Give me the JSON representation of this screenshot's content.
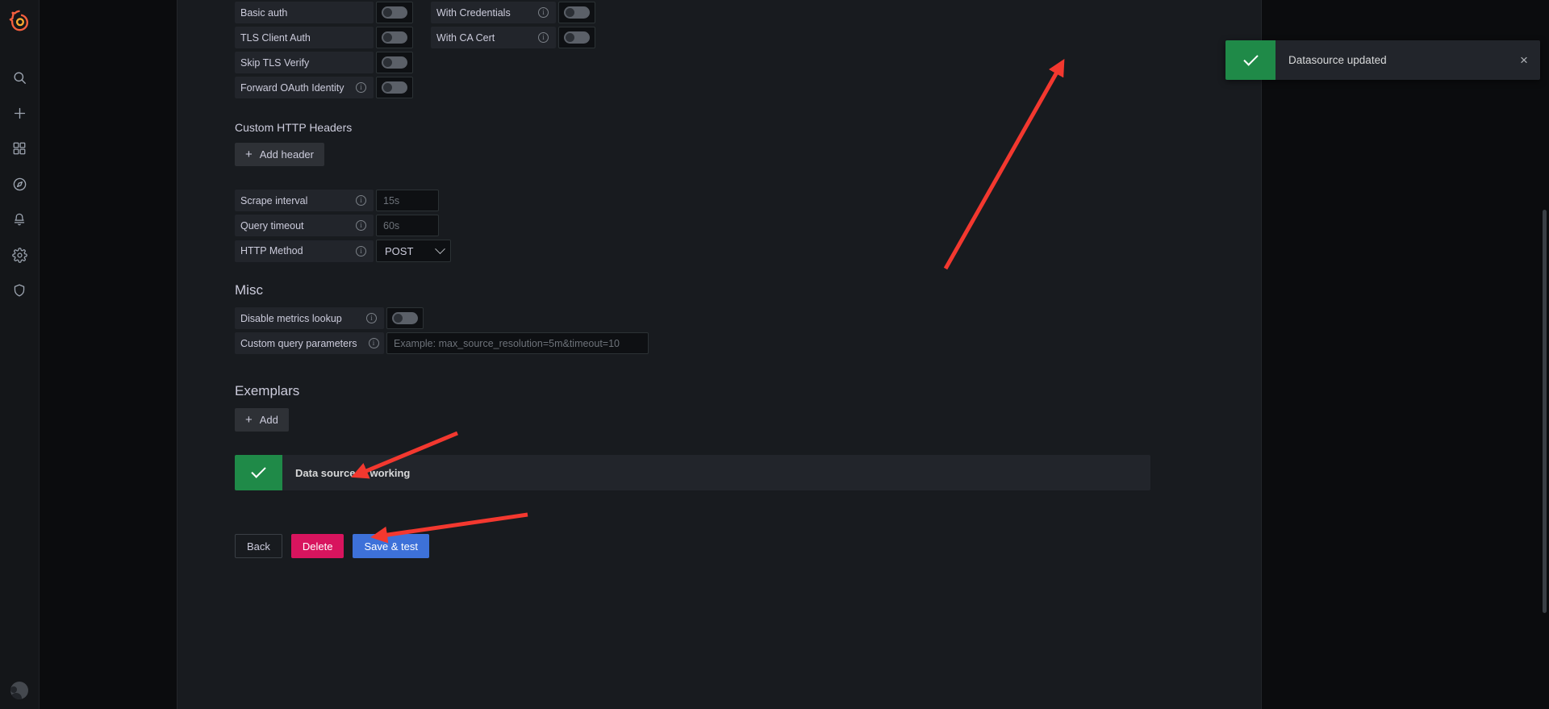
{
  "app": {
    "brand": "grafana",
    "accent_blue": "#3d71d9",
    "accent_green": "#1f8a48",
    "accent_pink": "#d8145e",
    "annotation_color": "#f3382f"
  },
  "sidebar": {
    "logo_name": "grafana-logo",
    "items": [
      {
        "name": "search-icon",
        "label": "Search"
      },
      {
        "name": "plus-icon",
        "label": "Create"
      },
      {
        "name": "dashboards-icon",
        "label": "Dashboards"
      },
      {
        "name": "explore-compass-icon",
        "label": "Explore"
      },
      {
        "name": "alerting-bell-icon",
        "label": "Alerting"
      },
      {
        "name": "configuration-gear-icon",
        "label": "Configuration"
      },
      {
        "name": "shield-icon",
        "label": "Server Admin"
      }
    ],
    "avatar_label": "User profile"
  },
  "auth_rows": [
    {
      "label": "Basic auth",
      "has_info": false,
      "toggle": "off",
      "second_label": "With Credentials",
      "second_has_info": true,
      "second_toggle": "off"
    },
    {
      "label": "TLS Client Auth",
      "has_info": false,
      "toggle": "off",
      "second_label": "With CA Cert",
      "second_has_info": true,
      "second_toggle": "off"
    },
    {
      "label": "Skip TLS Verify",
      "has_info": false,
      "toggle": "off",
      "second_label": "",
      "second_has_info": false,
      "second_toggle": ""
    },
    {
      "label": "Forward OAuth Identity",
      "has_info": true,
      "toggle": "off",
      "second_label": "",
      "second_has_info": false,
      "second_toggle": ""
    }
  ],
  "custom_headers": {
    "title": "Custom HTTP Headers",
    "add_button": "Add header"
  },
  "http_settings": [
    {
      "label": "Scrape interval",
      "has_info": true,
      "placeholder": "15s",
      "value": "",
      "type": "text"
    },
    {
      "label": "Query timeout",
      "has_info": true,
      "placeholder": "60s",
      "value": "",
      "type": "text"
    },
    {
      "label": "HTTP Method",
      "has_info": true,
      "value": "POST",
      "type": "select"
    }
  ],
  "misc": {
    "title": "Misc",
    "rows": [
      {
        "label": "Disable metrics lookup",
        "has_info": true,
        "type": "toggle",
        "toggle": "off"
      },
      {
        "label": "Custom query parameters",
        "has_info": true,
        "type": "text",
        "placeholder": "Example: max_source_resolution=5m&timeout=10",
        "value": ""
      }
    ]
  },
  "exemplars": {
    "title": "Exemplars",
    "add_button": "Add"
  },
  "test_result": {
    "icon": "check-icon",
    "message": "Data source is working"
  },
  "footer": {
    "back_label": "Back",
    "delete_label": "Delete",
    "save_label": "Save & test"
  },
  "toast": {
    "icon": "check-icon",
    "message": "Datasource updated",
    "close_label": "×"
  }
}
